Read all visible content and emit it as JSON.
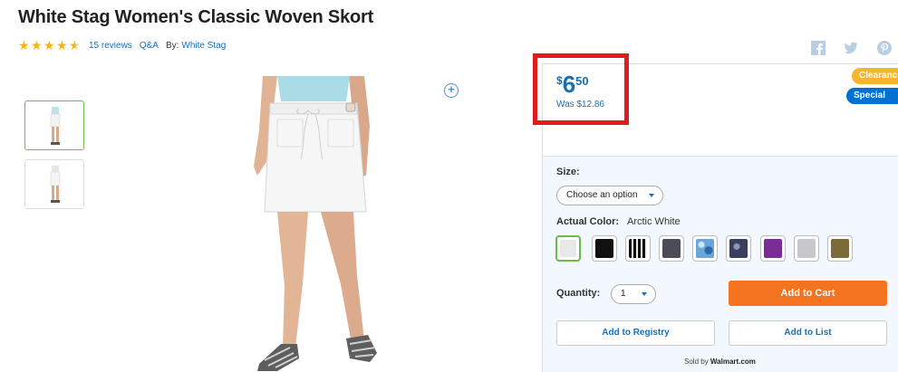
{
  "product": {
    "title": "White Stag Women's Classic Woven Skort",
    "rating": 4.5,
    "reviews_label": "15 reviews",
    "qa_label": "Q&A",
    "by_label": "By:",
    "brand": "White Stag"
  },
  "price": {
    "currency": "$",
    "dollars": "6",
    "cents": "50",
    "was": "Was $12.86"
  },
  "badges": {
    "clearance": "Clearance",
    "special_buy": "Special Buy"
  },
  "size": {
    "label": "Size:",
    "selected": "Choose an option"
  },
  "color": {
    "label": "Actual Color:",
    "selected": "Arctic White",
    "swatches": [
      "#e8e8e8",
      "#111111",
      "#1a1a1a",
      "#4a4c58",
      "#6aa6d8",
      "#3a3f5e",
      "#7a2e95",
      "#c7c7cc",
      "#7d6a3a"
    ]
  },
  "quantity": {
    "label": "Quantity:",
    "value": "1"
  },
  "buttons": {
    "add_to_cart": "Add to Cart",
    "add_to_registry": "Add to Registry",
    "add_to_list": "Add to List"
  },
  "sold_by": {
    "prefix": "Sold by",
    "seller": "Walmart.com"
  },
  "colors": {
    "accent_blue": "#1a6fb3",
    "cart_orange": "#f47321",
    "highlight_red": "#e11c1c",
    "selected_green": "#6bbd4a"
  }
}
